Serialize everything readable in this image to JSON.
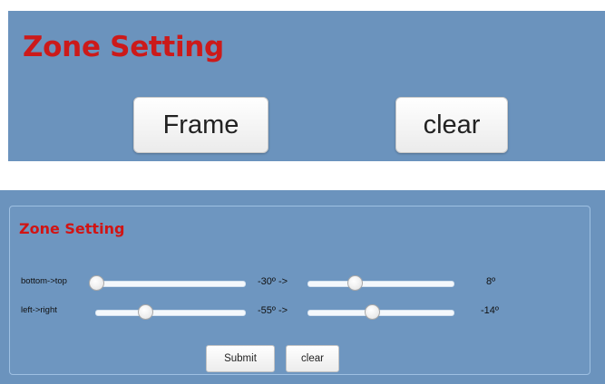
{
  "top_panel": {
    "title": "Zone Setting",
    "frame_label": "Frame",
    "clear_label": "clear"
  },
  "bottom_panel": {
    "title": "Zone Setting",
    "rows": [
      {
        "label": "bottom->top",
        "start_value": "-30º ->",
        "end_value": "8º",
        "start_slider_fraction": 0.0,
        "end_slider_fraction": 0.32
      },
      {
        "label": "left->right",
        "start_value": "-55º ->",
        "end_value": "-14º",
        "start_slider_fraction": 0.33,
        "end_slider_fraction": 0.44
      }
    ],
    "submit_label": "Submit",
    "clear_label": "clear"
  },
  "colors": {
    "panel_background": "#6b93bd",
    "title_red": "#cc1a1a"
  }
}
